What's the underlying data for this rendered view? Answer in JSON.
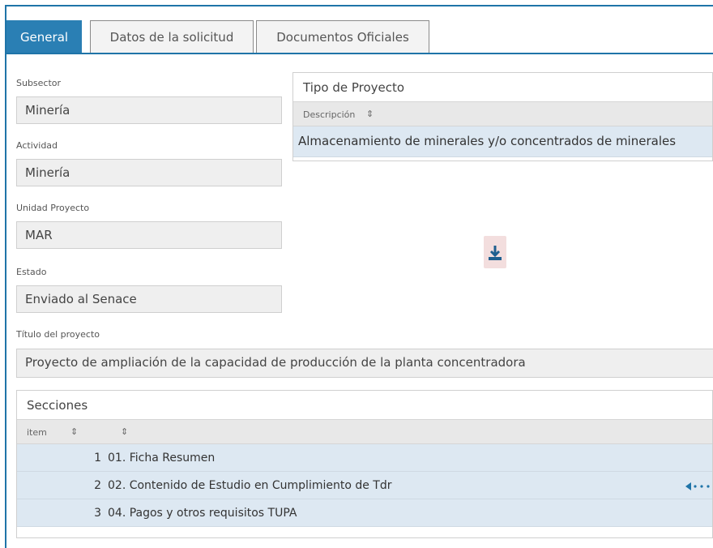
{
  "tabs": [
    {
      "label": "General"
    },
    {
      "label": "Datos de la solicitud"
    },
    {
      "label": "Documentos Oficiales"
    }
  ],
  "fields": {
    "subsector": {
      "label": "Subsector",
      "value": "Minería"
    },
    "actividad": {
      "label": "Actividad",
      "value": "Minería"
    },
    "unidad": {
      "label": "Unidad Proyecto",
      "value": "MAR"
    },
    "estado": {
      "label": "Estado",
      "value": "Enviado al Senace"
    },
    "titulo": {
      "label": "Título del proyecto",
      "value": "Proyecto de ampliación de la capacidad de producción de la planta concentradora"
    }
  },
  "tipo_proyecto": {
    "title": "Tipo de Proyecto",
    "column": "Descripción",
    "sort_glyph": "⇕",
    "rows": [
      "Almacenamiento de minerales y/o concentrados de minerales"
    ]
  },
  "secciones": {
    "title": "Secciones",
    "columns": [
      "item",
      ""
    ],
    "sort_glyph": "⇕",
    "rows": [
      {
        "item": "1",
        "name": "01. Ficha Resumen"
      },
      {
        "item": "2",
        "name": "02. Contenido de Estudio en Cumplimiento de Tdr"
      },
      {
        "item": "3",
        "name": "04. Pagos y otros requisitos TUPA"
      }
    ]
  },
  "icons": {
    "download": "download-icon",
    "pointer": "dotted-arrow-icon"
  },
  "colors": {
    "accent": "#2a7fb4",
    "row_selected": "#dde8f2",
    "field_bg": "#efefef"
  }
}
